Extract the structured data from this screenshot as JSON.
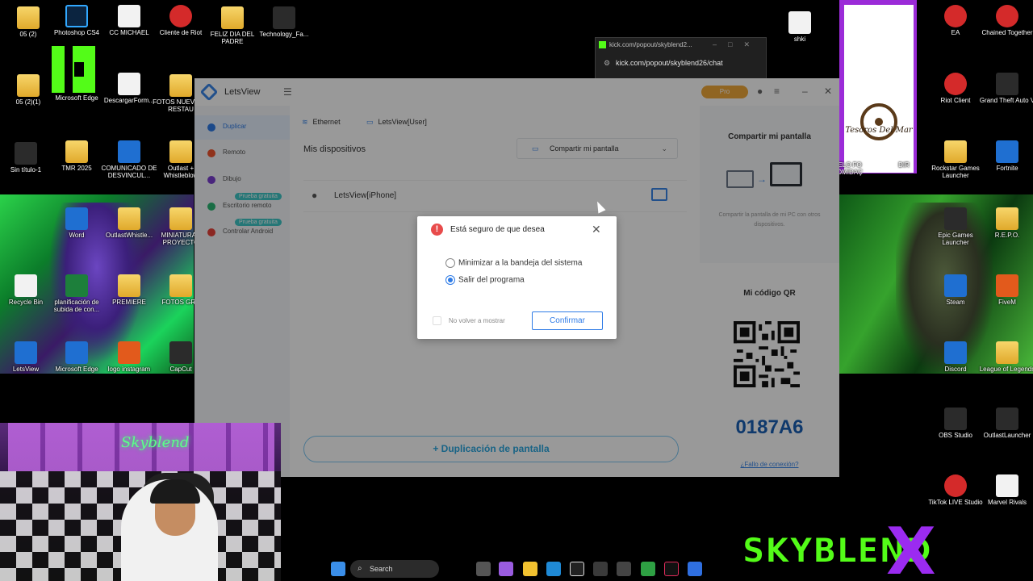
{
  "desktop": {
    "icons_left": [
      {
        "label": "05 (2)"
      },
      {
        "label": "Photoshop CS4"
      },
      {
        "label": "CC MICHAEL"
      },
      {
        "label": "Cliente de Riot"
      },
      {
        "label": "FELIZ DIA DEL PADRE"
      },
      {
        "label": "Technology_Fa..."
      },
      {
        "label": "05 (2)(1)"
      },
      {
        "label": "Microsoft Edge"
      },
      {
        "label": "DescargarForm..."
      },
      {
        "label": "FOTOS NUEV DEL RESTAU"
      },
      {
        "label": "Sin título-1"
      },
      {
        "label": "TMR 2025"
      },
      {
        "label": "COMUNICADO DE DESVINCUL..."
      },
      {
        "label": "Outlast + Whistleblow"
      },
      {
        "label": "Word"
      },
      {
        "label": "OutlastWhistle..."
      },
      {
        "label": "MINIATURAS PROYECTO"
      },
      {
        "label": "Recycle Bin"
      },
      {
        "label": "planificación de subida de con..."
      },
      {
        "label": "PREMIERE"
      },
      {
        "label": "FOTOS GRA"
      },
      {
        "label": "LetsView"
      },
      {
        "label": "Microsoft Edge"
      },
      {
        "label": "logo instagram"
      },
      {
        "label": "CapCut"
      }
    ],
    "icons_right": [
      {
        "label": "shki"
      },
      {
        "label": "EA"
      },
      {
        "label": "Chained Together"
      },
      {
        "label": "Riot Client"
      },
      {
        "label": "Grand Theft Auto V"
      },
      {
        "label": "GELO FO COMIDAÇ"
      },
      {
        "label": "DIR"
      },
      {
        "label": "Rockstar Games Launcher"
      },
      {
        "label": "Fortnite"
      },
      {
        "label": "Epic Games Launcher"
      },
      {
        "label": "R.E.P.O."
      },
      {
        "label": "Steam"
      },
      {
        "label": "FiveM"
      },
      {
        "label": "Discord"
      },
      {
        "label": "League of Legends"
      },
      {
        "label": "OBS Studio"
      },
      {
        "label": "OutlastLauncher"
      },
      {
        "label": "TikTok LIVE Studio"
      },
      {
        "label": "Marvel Rivals"
      }
    ],
    "tesoros_text": "Tesoros Del Mar"
  },
  "kick_popout": {
    "title": "kick.com/popout/skyblend2...",
    "url": "kick.com/popout/skyblend26/chat"
  },
  "letsview": {
    "app_name": "LetsView",
    "pro_label": "Pro",
    "sidebar": [
      {
        "label": "Duplicar",
        "color": "#2e7be6"
      },
      {
        "label": "Remoto",
        "color": "#f0542d"
      },
      {
        "label": "Dibujo",
        "color": "#7b3fd1"
      },
      {
        "label": "Escritorio remoto",
        "color": "#2bb673",
        "badge": "Prueba gratuita"
      },
      {
        "label": "Controlar Android",
        "color": "#e8423a",
        "badge": "Prueba gratuita"
      }
    ],
    "tabs": [
      {
        "label": "Ethernet"
      },
      {
        "label": "LetsView[User]"
      }
    ],
    "my_devices": "Mis dispositivos",
    "share_dropdown": "Compartir mi pantalla",
    "device_name": "LetsView[iPhone]",
    "duplicate_button": "+ Duplicación de pantalla",
    "right_panel": {
      "share_title": "Compartir mi pantalla",
      "share_desc": "Compartir la pantalla de mi PC con otros dispositivos.",
      "qr_title": "Mi código QR",
      "code": "0187A6",
      "fail_link": "¿Fallo de conexión?"
    }
  },
  "dialog": {
    "title": "Está seguro de que desea",
    "options": [
      {
        "label": "Minimizar a la bandeja del sistema",
        "selected": false
      },
      {
        "label": "Salir del programa",
        "selected": true
      }
    ],
    "dont_show": "No volver a mostrar",
    "confirm": "Confirmar"
  },
  "webcam": {
    "neon_sign": "Skyblend"
  },
  "taskbar": {
    "search_placeholder": "Search"
  },
  "brand": {
    "text": "SKYBLEND",
    "x": "X"
  }
}
